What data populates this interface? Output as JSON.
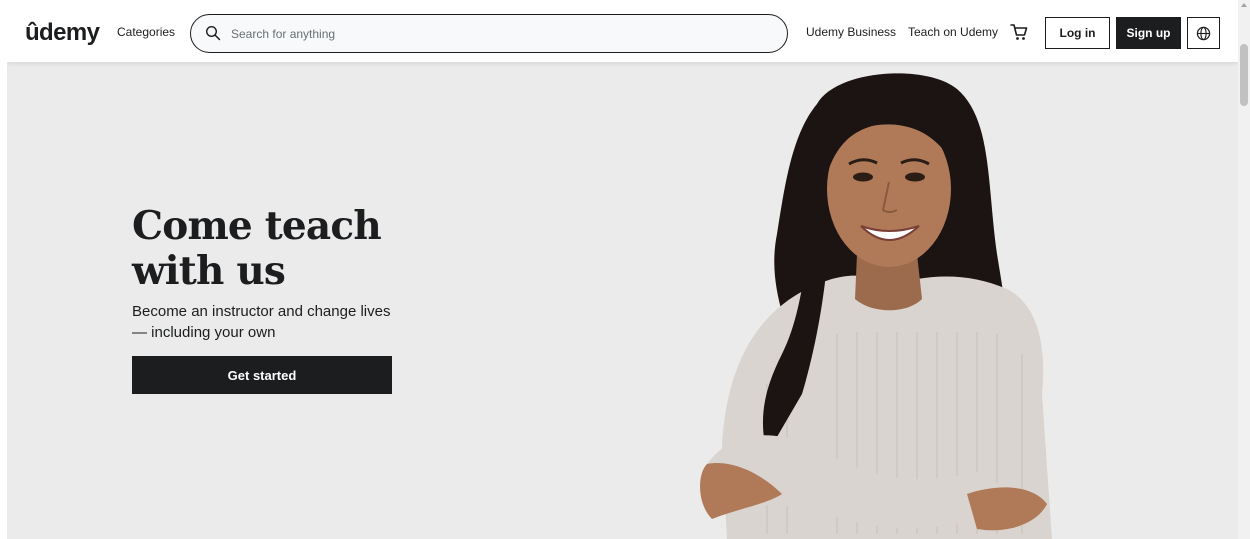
{
  "header": {
    "logo": "ûdemy",
    "categories": "Categories",
    "search": {
      "placeholder": "Search for anything",
      "value": ""
    },
    "nav": {
      "business": "Udemy Business",
      "teach": "Teach on Udemy"
    },
    "login_label": "Log in",
    "signup_label": "Sign up",
    "icons": {
      "search": "search-icon",
      "cart": "cart-icon",
      "language": "globe-icon"
    }
  },
  "hero": {
    "title_line1": "Come teach",
    "title_line2": "with us",
    "subtitle": "Become an instructor and change lives — including your own",
    "cta_label": "Get started"
  },
  "colors": {
    "dark": "#1c1d1f",
    "hero_bg": "#ebebeb",
    "brand_purple": "#a435f0"
  }
}
